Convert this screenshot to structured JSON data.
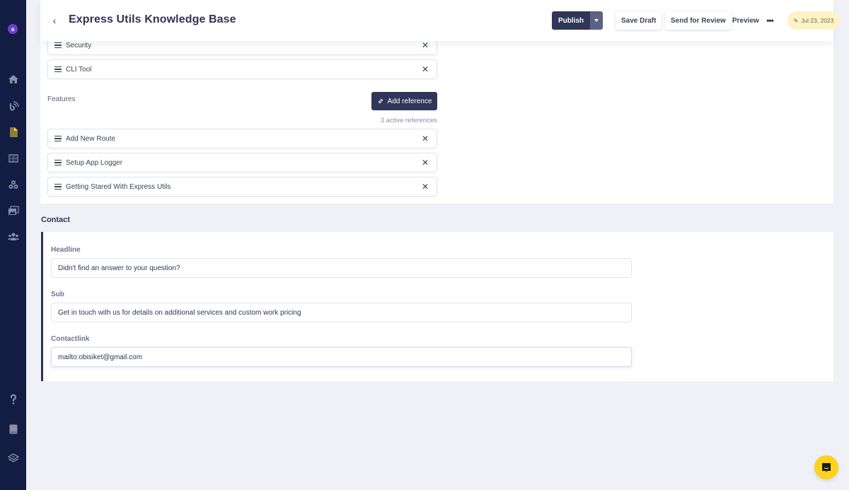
{
  "sidebar": {
    "avatar_letter": "a",
    "top_icons": [
      "home-icon",
      "feed-icon",
      "document-icon",
      "layout-icon",
      "components-icon",
      "media-icon",
      "users-icon"
    ],
    "bottom_icons": [
      "help-icon",
      "book-icon",
      "layers-icon"
    ]
  },
  "header": {
    "back_label": "‹",
    "title": "Express Utils Knowledge Base",
    "publish_label": "Publish",
    "save_draft_label": "Save Draft",
    "send_review_label": "Send for Review",
    "preview_label": "Preview",
    "more_label": "•••",
    "date_badge": "Jul 23, 2023"
  },
  "references": {
    "upper_items": [
      {
        "label": "Security"
      },
      {
        "label": "CLI Tool"
      }
    ],
    "features": {
      "label": "Features",
      "add_reference_label": "Add reference",
      "active_count_text": "3 active references",
      "items": [
        {
          "label": "Add New Route"
        },
        {
          "label": "Setup App Logger"
        },
        {
          "label": "Getting Stared With Express Utils"
        }
      ]
    },
    "remove_glyph": "✕"
  },
  "contact": {
    "heading": "Contact",
    "fields": [
      {
        "label": "Headline",
        "value": "Didn't find an answer to your question?"
      },
      {
        "label": "Sub",
        "value": "Get in touch with us for details on additional services and custom work pricing"
      },
      {
        "label": "Contactlink",
        "value": "mailto:obisiket@gmail.com"
      }
    ]
  },
  "colors": {
    "sidebar_bg": "#131c43",
    "primary_button": "#2f3658",
    "date_badge_bg": "#fdf3c4",
    "chat_button": "#fcd21c",
    "avatar": "#6a3fd4"
  }
}
